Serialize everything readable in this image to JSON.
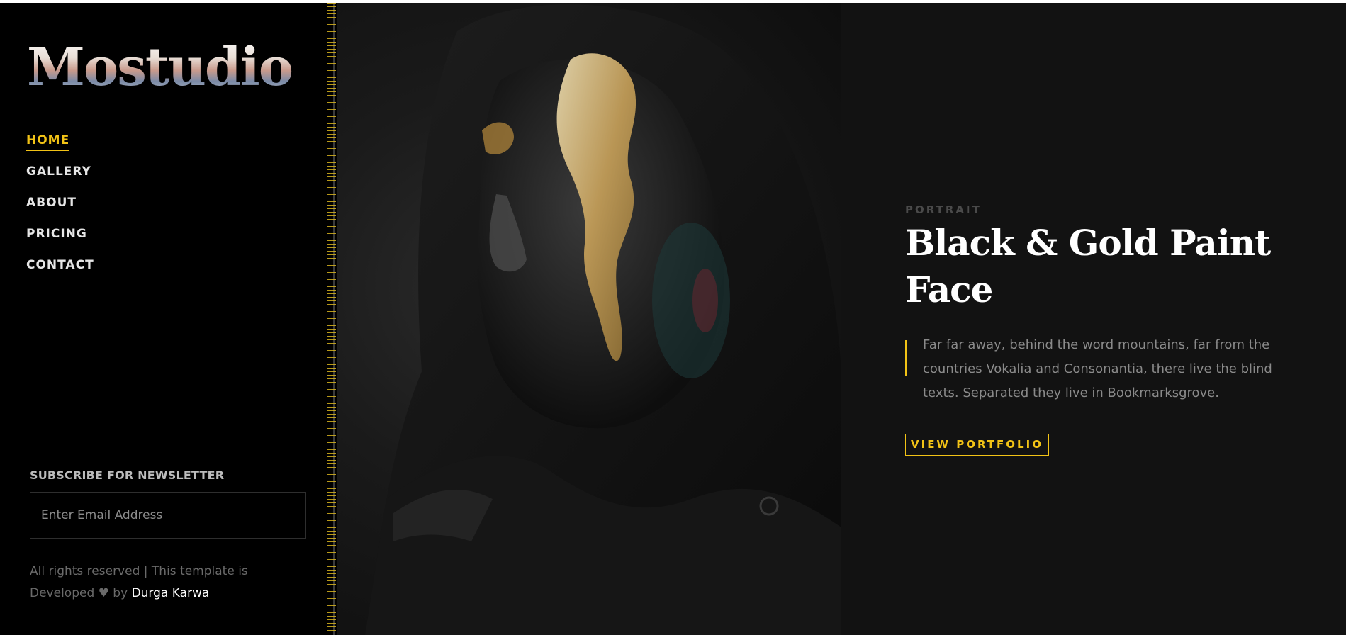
{
  "brand": {
    "logo_text": "Mostudio"
  },
  "nav": {
    "items": [
      {
        "label": "HOME",
        "active": true
      },
      {
        "label": "GALLERY",
        "active": false
      },
      {
        "label": "ABOUT",
        "active": false
      },
      {
        "label": "PRICING",
        "active": false
      },
      {
        "label": "CONTACT",
        "active": false
      }
    ]
  },
  "newsletter": {
    "title": "SUBSCRIBE FOR NEWSLETTER",
    "placeholder": "Enter Email Address"
  },
  "footer": {
    "text_before": "All rights reserved | This template is Developed",
    "heart_icon": "heart-icon",
    "by": "by",
    "author": "Durga Karwa"
  },
  "hero": {
    "kicker": "PORTRAIT",
    "title": "Black & Gold Paint Face",
    "paragraph": "Far far away, behind the word mountains, far from the countries Vokalia and Consonantia, there live the blind texts. Separated they live in Bookmarksgrove.",
    "button_label": "VIEW PORTFOLIO"
  },
  "colors": {
    "accent": "#f2c316",
    "sidebar_bg": "#000000",
    "content_bg": "#121212"
  }
}
